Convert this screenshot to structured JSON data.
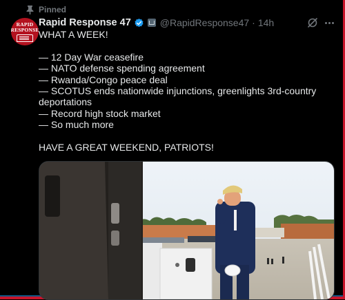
{
  "pinned_label": "Pinned",
  "author": {
    "display_name": "Rapid Response 47",
    "handle": "@RapidResponse47",
    "separator": "·",
    "timestamp": "14h",
    "avatar_text_line1": "RAPID",
    "avatar_text_line2": "RESPONSE"
  },
  "tweet": {
    "lines": [
      "WHAT A WEEK!",
      "",
      "— 12 Day War ceasefire",
      "— NATO defense spending agreement",
      "— Rwanda/Congo peace deal",
      "— SCOTUS ends nationwide injunctions, greenlights 3rd-country deportations",
      "— Record high stock market",
      "— So much more",
      "",
      "HAVE A GREAT WEEKEND, PATRIOTS!"
    ]
  },
  "icons": {
    "pin": "pin-icon",
    "verified": "verified-badge-icon",
    "affiliate": "affiliate-badge-icon",
    "grok": "grok-icon",
    "more": "more-icon"
  },
  "colors": {
    "background": "#000000",
    "text": "#e7e9ea",
    "secondary": "#71767b",
    "verified": "#1d9bf0",
    "frame": "#c8142a"
  }
}
